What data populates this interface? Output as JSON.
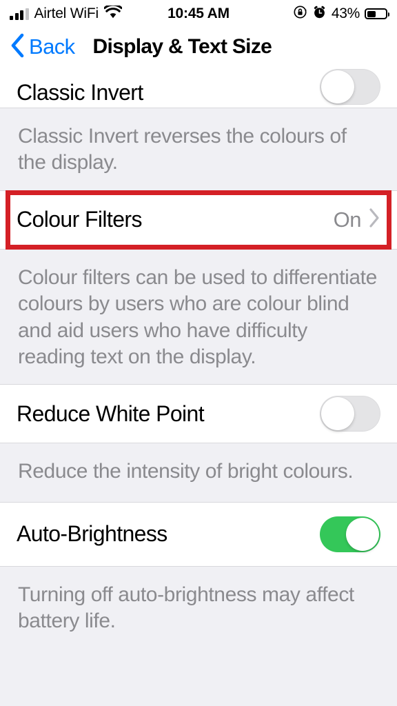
{
  "status_bar": {
    "carrier": "Airtel WiFi",
    "time": "10:45 AM",
    "battery_percent": "43%",
    "battery_level": 43,
    "signal_bars_filled": 3,
    "signal_bars_total": 4,
    "icons": [
      "signal-bars-icon",
      "wifi-icon",
      "rotation-lock-icon",
      "alarm-clock-icon",
      "battery-icon"
    ]
  },
  "nav_bar": {
    "back_label": "Back",
    "title": "Display & Text Size",
    "back_icon": "chevron-left-icon",
    "accent_color": "#007AFF"
  },
  "rows": {
    "classic_invert": {
      "label": "Classic Invert",
      "toggle_state": "off",
      "footer": "Classic Invert reverses the colours of the display."
    },
    "colour_filters": {
      "label": "Colour Filters",
      "value": "On",
      "disclosure_icon": "chevron-right-icon",
      "footer": "Colour filters can be used to differentiate colours by users who are colour blind and aid users who have difficulty reading text on the display.",
      "highlighted": true,
      "highlight_color": "#D42026"
    },
    "reduce_white_point": {
      "label": "Reduce White Point",
      "toggle_state": "off",
      "footer": "Reduce the intensity of bright colours."
    },
    "auto_brightness": {
      "label": "Auto-Brightness",
      "toggle_state": "on",
      "toggle_on_color": "#34C759",
      "footer": "Turning off auto-brightness may affect battery life."
    }
  }
}
